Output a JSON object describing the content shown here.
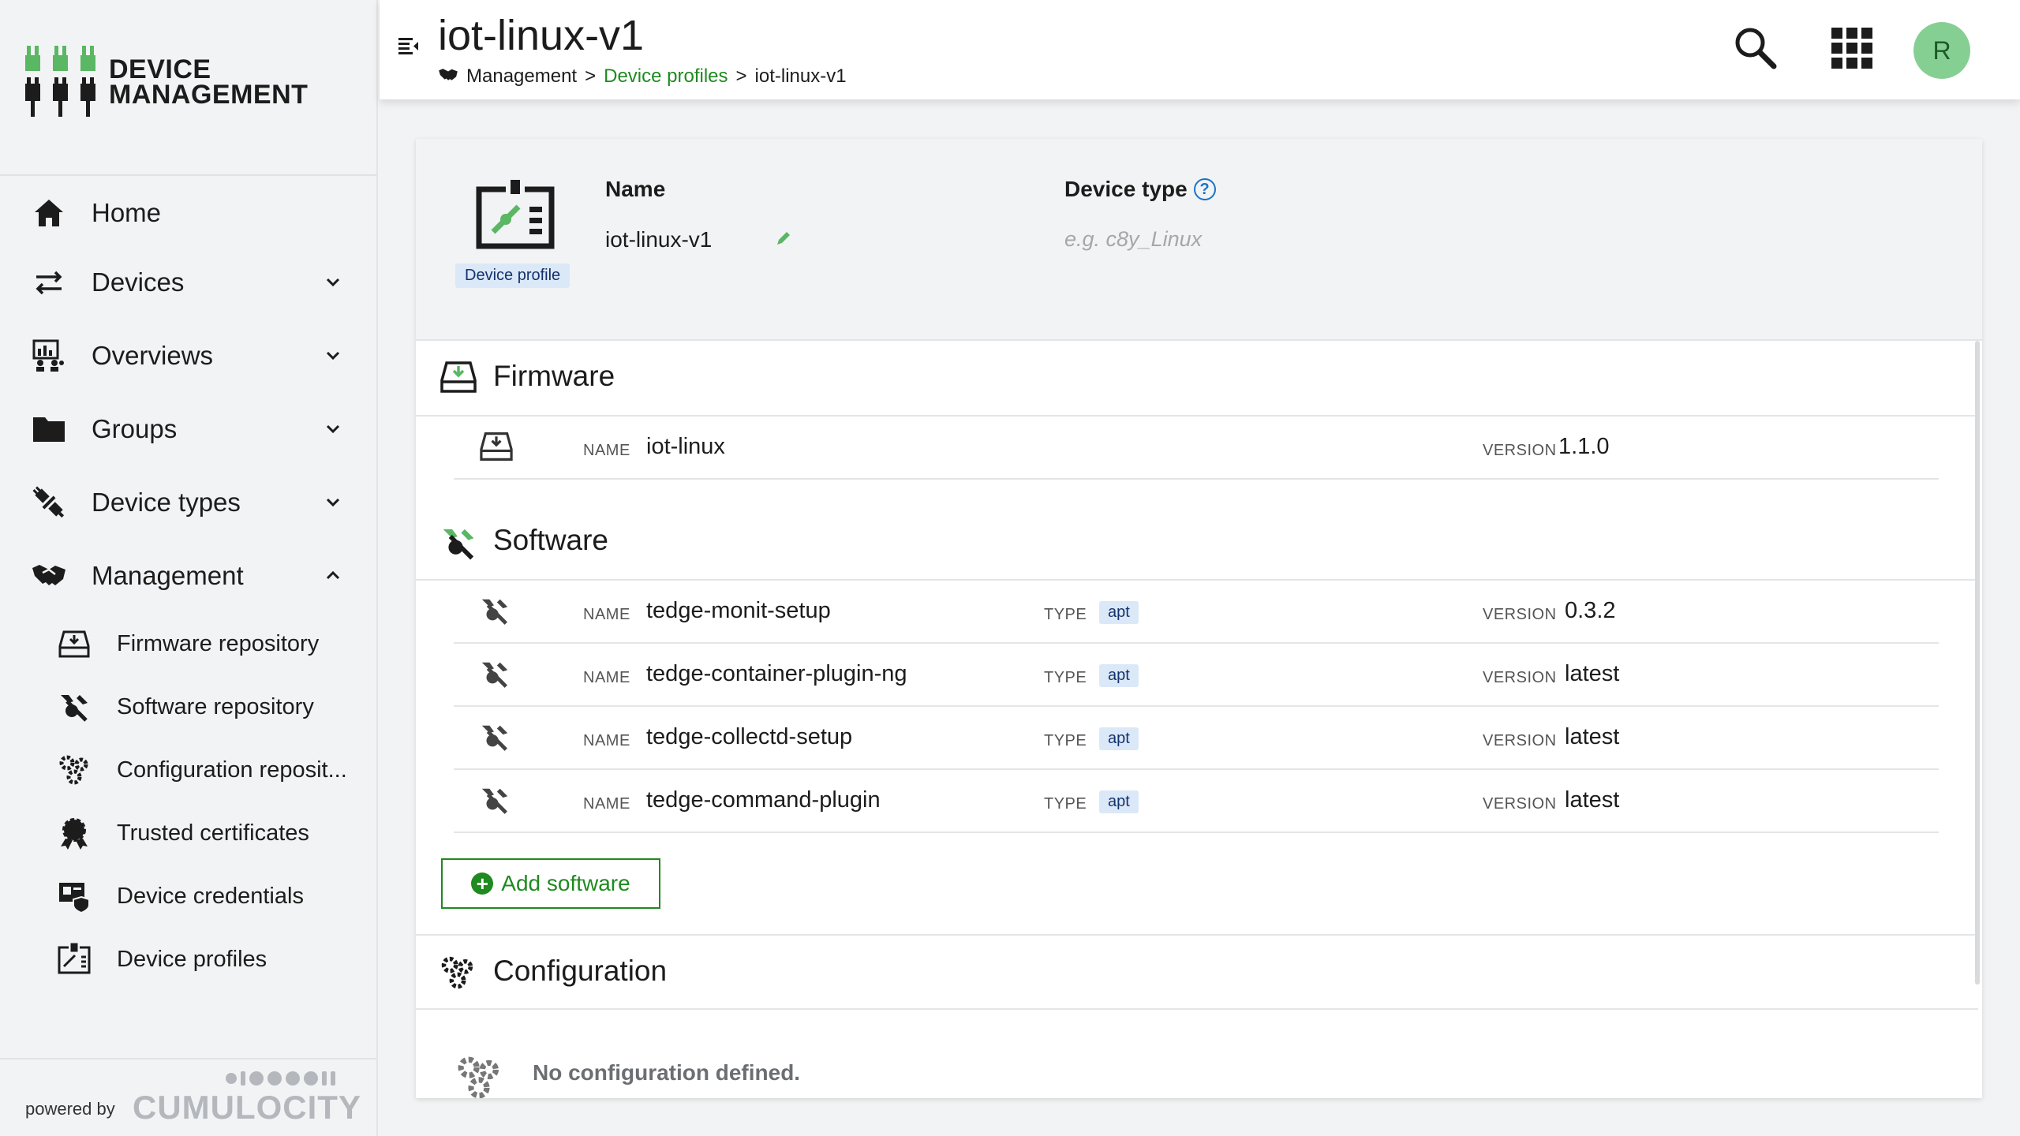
{
  "app": {
    "brand_line1": "DEVICE",
    "brand_line2": "MANAGEMENT",
    "powered_by": "powered by",
    "vendor": "CUMULOCITY",
    "accent": "#1f8a1f"
  },
  "nav": {
    "items": [
      {
        "label": "Home",
        "icon": "home-icon"
      },
      {
        "label": "Devices",
        "icon": "devices-arrows-icon",
        "expandable": true,
        "expanded": false
      },
      {
        "label": "Overviews",
        "icon": "overviews-icon",
        "expandable": true,
        "expanded": false
      },
      {
        "label": "Groups",
        "icon": "folder-icon",
        "expandable": true,
        "expanded": false
      },
      {
        "label": "Device types",
        "icon": "device-types-icon",
        "expandable": true,
        "expanded": false
      },
      {
        "label": "Management",
        "icon": "handshake-icon",
        "expandable": true,
        "expanded": true
      }
    ],
    "sub_items": [
      {
        "label": "Firmware repository",
        "icon": "firmware-icon"
      },
      {
        "label": "Software repository",
        "icon": "software-icon"
      },
      {
        "label": "Configuration reposit...",
        "icon": "configuration-icon"
      },
      {
        "label": "Trusted certificates",
        "icon": "certificate-icon"
      },
      {
        "label": "Device credentials",
        "icon": "credentials-icon"
      },
      {
        "label": "Device profiles",
        "icon": "device-profile-icon"
      }
    ]
  },
  "header": {
    "title": "iot-linux-v1",
    "breadcrumb": {
      "root": "Management",
      "sep1": ">",
      "middle": "Device profiles",
      "sep2": ">",
      "current": "iot-linux-v1"
    },
    "avatar_initial": "R"
  },
  "profile": {
    "badge": "Device profile",
    "name_label": "Name",
    "name_value": "iot-linux-v1",
    "device_type_label": "Device type",
    "device_type_help": "?",
    "device_type_placeholder": "e.g. c8y_Linux"
  },
  "firmware": {
    "title": "Firmware",
    "name_caption": "NAME",
    "version_caption": "VERSION",
    "name": "iot-linux",
    "version": "1.1.0"
  },
  "software": {
    "title": "Software",
    "name_caption": "NAME",
    "type_caption": "TYPE",
    "version_caption": "VERSION",
    "items": [
      {
        "name": "tedge-monit-setup",
        "type": "apt",
        "version": "0.3.2"
      },
      {
        "name": "tedge-container-plugin-ng",
        "type": "apt",
        "version": "latest"
      },
      {
        "name": "tedge-collectd-setup",
        "type": "apt",
        "version": "latest"
      },
      {
        "name": "tedge-command-plugin",
        "type": "apt",
        "version": "latest"
      }
    ],
    "add_label": "Add software",
    "add_icon": "+"
  },
  "configuration": {
    "title": "Configuration",
    "empty": "No configuration defined."
  }
}
